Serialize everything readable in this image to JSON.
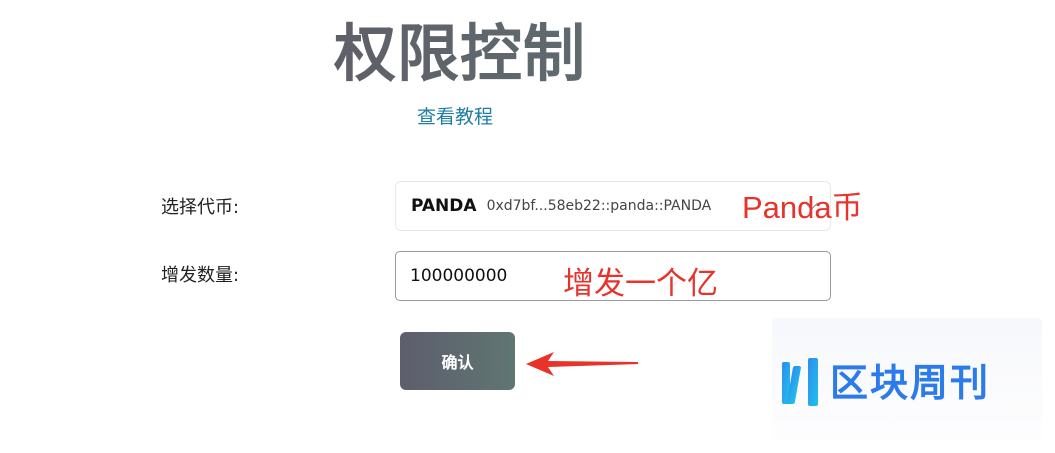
{
  "page": {
    "title": "权限控制",
    "tutorial_link": "查看教程"
  },
  "form": {
    "token_label": "选择代币:",
    "token_symbol": "PANDA",
    "token_address": "0xd7bf...58eb22::panda::PANDA",
    "amount_label": "增发数量:",
    "amount_value": "100000000",
    "confirm_label": "确认"
  },
  "annotations": {
    "token_note": "Panda币",
    "amount_note": "增发一个亿",
    "color": "#e8322a"
  },
  "watermark": {
    "text": "区块周刊",
    "color": "#2b7bea"
  }
}
